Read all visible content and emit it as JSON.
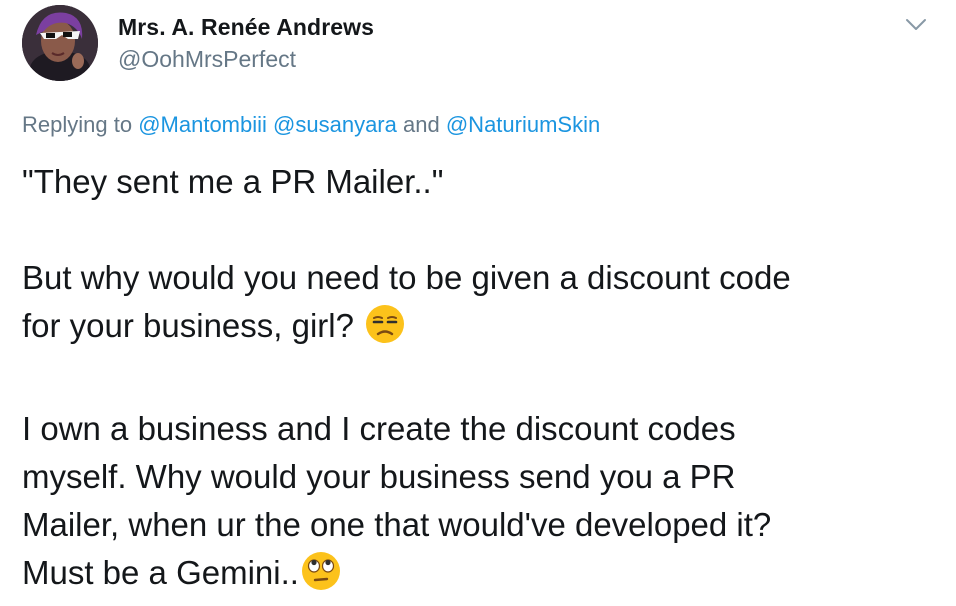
{
  "tweet": {
    "author_name": "Mrs. A. Renée Andrews",
    "author_handle": "@OohMrsPerfect",
    "avatar_icon": "profile-photo",
    "menu_icon": "chevron-down-icon",
    "replying": {
      "prefix": "Replying to",
      "mentions": [
        "@Mantombiii",
        "@susanyara",
        "@NaturiumSkin"
      ],
      "separator": "and"
    },
    "body": {
      "p1_line1": "\"They sent me a PR Mailer..\"",
      "p2_line1": "But why would you need to be given a discount code",
      "p2_line2": "for your business, girl?",
      "p2_emoji": "unamused-face-icon",
      "p3_line1": "I own a business and I create the discount codes",
      "p3_line2": "myself.  Why would your business send you a PR",
      "p3_line3": "Mailer, when ur the one that would've developed it?",
      "p3_line4": "Must be a Gemini..",
      "p3_emoji": "eye-roll-face-icon"
    },
    "colors": {
      "text": "#14171a",
      "secondary": "#657786",
      "link": "#1b95e0",
      "emoji": "#fcc21b"
    }
  }
}
